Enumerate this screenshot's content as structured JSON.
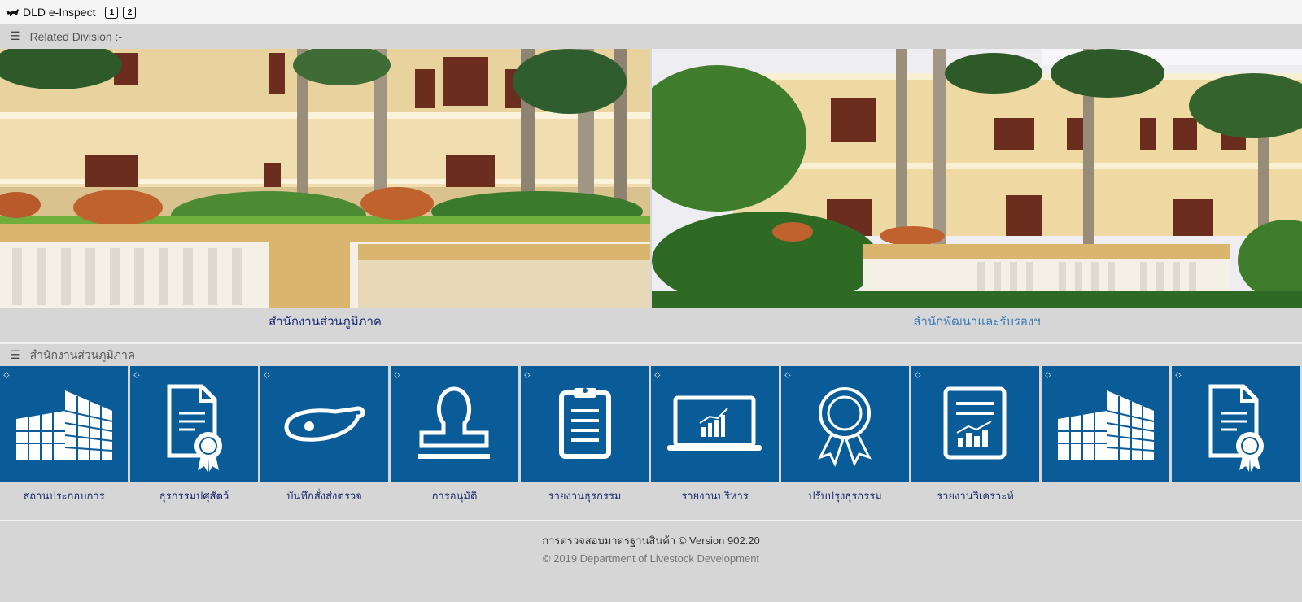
{
  "header": {
    "app_title": "DLD e-Inspect",
    "page_buttons": [
      "1",
      "2"
    ]
  },
  "related_division": {
    "section_title": "Related Division :-",
    "cards": [
      {
        "caption": "สำนักงานส่วนภูมิภาค",
        "color": "#1a2a7a"
      },
      {
        "caption": "สำนักพัฒนาและรับรองฯ",
        "color": "#3a7ab8"
      }
    ]
  },
  "regional_office": {
    "section_title": "สำนักงานส่วนภูมิภาค",
    "tiles": [
      {
        "label": "สถานประกอบการ",
        "icon": "building-icon"
      },
      {
        "label": "ธุรกรรมปศุสัตว์",
        "icon": "certificate-document-icon"
      },
      {
        "label": "บันทึกสั่งส่งตรวจ",
        "icon": "meat-icon"
      },
      {
        "label": "การอนุมัติ",
        "icon": "stamp-icon"
      },
      {
        "label": "รายงานธุรกรรม",
        "icon": "clipboard-icon"
      },
      {
        "label": "รายงานบริหาร",
        "icon": "laptop-chart-icon"
      },
      {
        "label": "ปรับปรุงธุรกรรม",
        "icon": "award-ribbon-icon"
      },
      {
        "label": "รายงานวิเคราะห์",
        "icon": "report-chart-icon"
      },
      {
        "label": "",
        "icon": "building-icon"
      },
      {
        "label": "",
        "icon": "certificate-document-icon"
      }
    ]
  },
  "footer": {
    "version_text": "การตรวจสอบมาตรฐานสินค้า © Version 902.20",
    "copyright": "© 2019 Department of Livestock Development"
  },
  "colors": {
    "tile_blue": "#0a5c99",
    "background": "#d6d6d6"
  }
}
